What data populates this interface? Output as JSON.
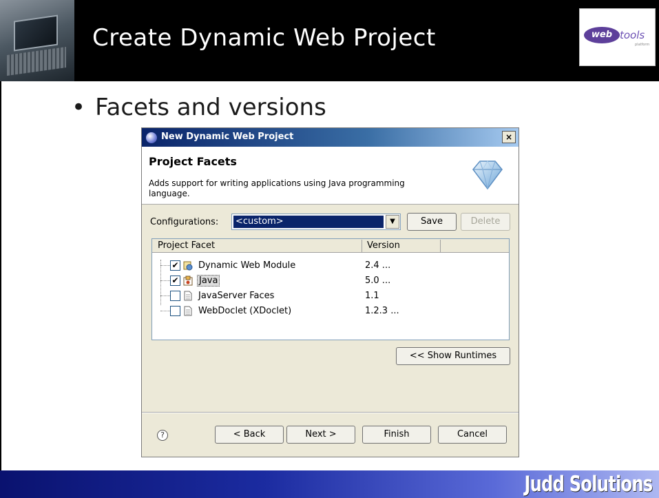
{
  "slide": {
    "title": "Create Dynamic Web Project",
    "bullet": "Facets and versions",
    "footer_brand": "Judd Solutions",
    "logo": {
      "text_a": "web",
      "text_b": "tools",
      "sub": "platform"
    }
  },
  "dialog": {
    "window_title": "New Dynamic Web Project",
    "close_glyph": "×",
    "heading": "Project Facets",
    "description": "Adds support for writing applications using Java programming language.",
    "configurations": {
      "label": "Configurations:",
      "selected": "<custom>",
      "arrow_glyph": "▼",
      "save": "Save",
      "delete": "Delete"
    },
    "table": {
      "columns": [
        "Project Facet",
        "Version"
      ],
      "rows": [
        {
          "name": "Dynamic Web Module",
          "version": "2.4 ...",
          "checked": "✔",
          "icon": "web-module-icon"
        },
        {
          "name": "Java",
          "version": "5.0 ...",
          "checked": "✔",
          "icon": "java-icon"
        },
        {
          "name": "JavaServer Faces",
          "version": "1.1",
          "checked": "",
          "icon": "file-icon"
        },
        {
          "name": "WebDoclet (XDoclet)",
          "version": "1.2.3 ...",
          "checked": "",
          "icon": "file-icon"
        }
      ]
    },
    "show_runtimes": "<< Show Runtimes",
    "help_glyph": "?",
    "buttons": {
      "back": "< Back",
      "next": "Next >",
      "finish": "Finish",
      "cancel": "Cancel"
    }
  },
  "colors": {
    "header_bg": "#000000",
    "title_bar": "#0a246a",
    "dialog_bg": "#ece9d8",
    "footer_gradient_start": "#0a126f",
    "selection": "#0a246a"
  }
}
